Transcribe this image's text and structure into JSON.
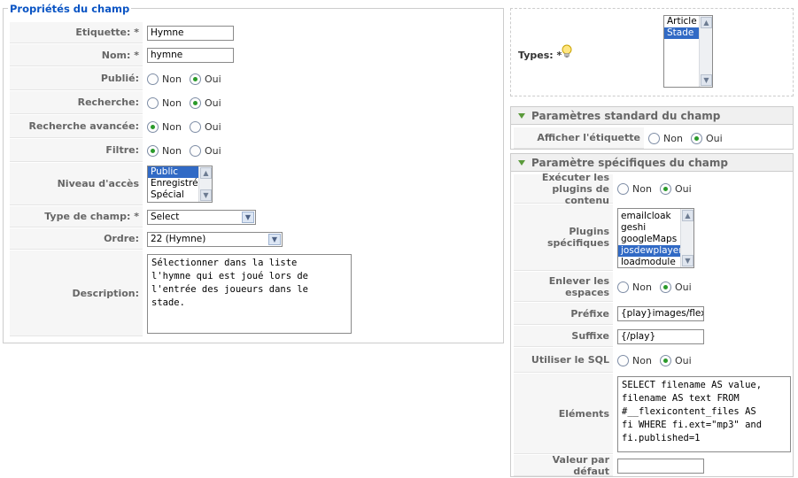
{
  "left": {
    "legend": "Propriétés du champ",
    "fields": {
      "etiquette": {
        "label": "Etiquette: *",
        "value": "Hymne"
      },
      "nom": {
        "label": "Nom: *",
        "value": "hymne"
      },
      "publie": {
        "label": "Publié:",
        "opt_non": "Non",
        "opt_oui": "Oui",
        "selected": "Oui"
      },
      "recherche": {
        "label": "Recherche:",
        "opt_non": "Non",
        "opt_oui": "Oui",
        "selected": "Oui"
      },
      "recherche_avancee": {
        "label": "Recherche avancée:",
        "opt_non": "Non",
        "opt_oui": "Oui",
        "selected": "Non"
      },
      "filtre": {
        "label": "Filtre:",
        "opt_non": "Non",
        "opt_oui": "Oui",
        "selected": "Non"
      },
      "niveau_acces": {
        "label": "Niveau d'accès",
        "options": [
          "Public",
          "Enregistré",
          "Spécial"
        ],
        "selected": "Public"
      },
      "type_champ": {
        "label": "Type de champ: *",
        "value": "Select"
      },
      "ordre": {
        "label": "Ordre:",
        "value": "22 (Hymne)"
      },
      "description": {
        "label": "Description:",
        "value": "Sélectionner dans la liste\nl'hymne qui est joué lors de\nl'entrée des joueurs dans le\nstade."
      }
    }
  },
  "types": {
    "label": "Types: *",
    "options": [
      "Article",
      "Stade"
    ],
    "selected": "Stade"
  },
  "standard": {
    "title": "Paramètres standard du champ",
    "afficher": {
      "label": "Afficher l'étiquette",
      "opt_non": "Non",
      "opt_oui": "Oui",
      "selected": "Oui"
    }
  },
  "specific": {
    "title": "Paramètre spécifiques du champ",
    "executer": {
      "label_1": "Exécuter les",
      "label_2": "plugins de contenu",
      "opt_non": "Non",
      "opt_oui": "Oui",
      "selected": "Oui"
    },
    "plugins": {
      "label_1": "Plugins",
      "label_2": "spécifiques",
      "options": [
        "emailcloak",
        "geshi",
        "googleMaps",
        "josdewplayer",
        "loadmodule"
      ],
      "selected": "josdewplayer"
    },
    "enlever": {
      "label_1": "Enlever les",
      "label_2": "espaces",
      "opt_non": "Non",
      "opt_oui": "Oui",
      "selected": "Oui"
    },
    "prefixe": {
      "label": "Préfixe",
      "value": "{play}images/flexicon"
    },
    "suffixe": {
      "label": "Suffixe",
      "value": "{/play}"
    },
    "sql": {
      "label": "Utiliser le SQL",
      "opt_non": "Non",
      "opt_oui": "Oui",
      "selected": "Oui"
    },
    "elements": {
      "label": "Eléments",
      "value": "SELECT filename AS value,\nfilename AS text FROM\n#__flexicontent_files AS\nfi WHERE fi.ext=\"mp3\" and\nfi.published=1"
    },
    "defaut": {
      "label": "Valeur par défaut",
      "value": ""
    }
  },
  "colors": {
    "legend": "#0b55c4",
    "radio_dot": "#2a9a2a",
    "selection": "#316ac5",
    "triangle": "#5a9a3a"
  },
  "icons": {
    "types_hint": "lightbulb-icon",
    "panel_toggle": "triangle-down-icon"
  }
}
